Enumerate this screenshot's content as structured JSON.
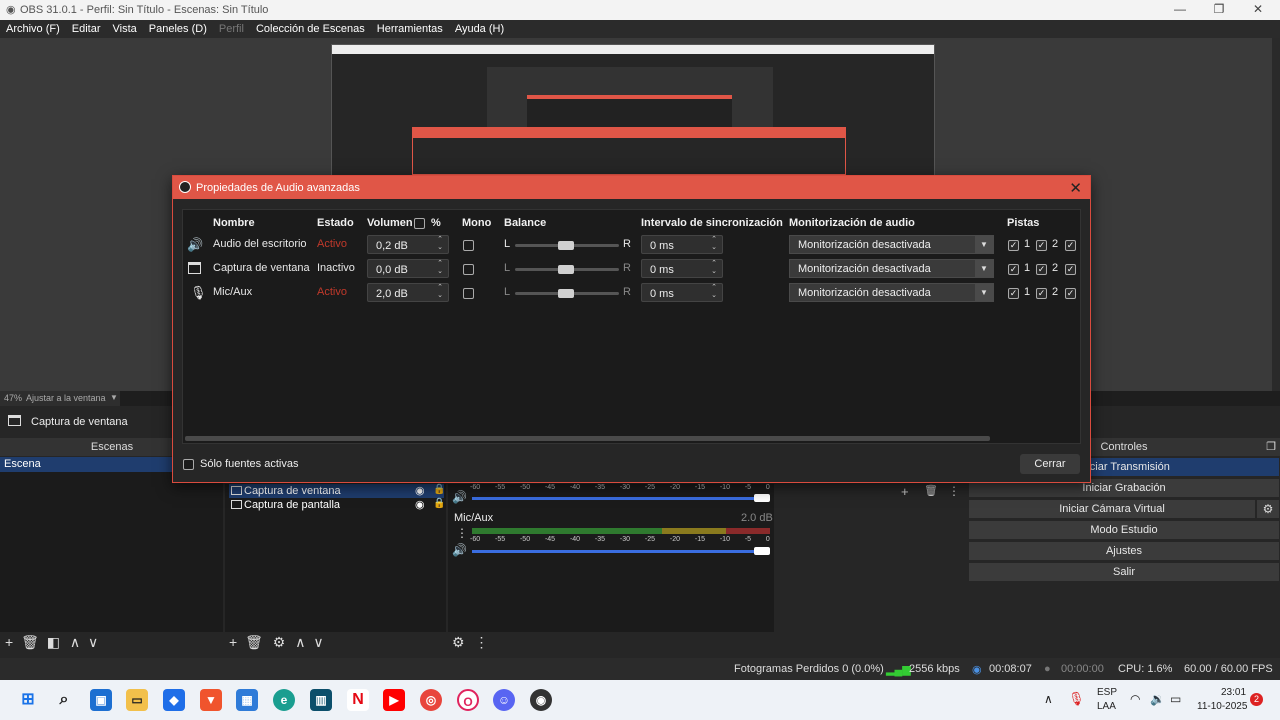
{
  "window": {
    "title": "OBS 31.0.1 - Perfil: Sin Título - Escenas: Sin Título"
  },
  "menu": [
    "Archivo (F)",
    "Editar",
    "Vista",
    "Paneles (D)",
    "Perfil",
    "Colección de Escenas",
    "Herramientas",
    "Ayuda (H)"
  ],
  "zoom": {
    "pct": "47%",
    "label": "Ajustar a la ventana"
  },
  "source_header": {
    "label": "Captura de ventana"
  },
  "scenes": {
    "header": "Escenas",
    "items": [
      "Escena"
    ]
  },
  "sources": {
    "items": [
      "Captura de ventana",
      "Captura de pantalla"
    ]
  },
  "mixer": {
    "ticks": [
      "-60",
      "-55",
      "-50",
      "-45",
      "-40",
      "-35",
      "-30",
      "-25",
      "-20",
      "-15",
      "-10",
      "-5",
      "0"
    ],
    "mic_label": "Mic/Aux",
    "mic_db": "2.0 dB"
  },
  "controls": {
    "header": "Controles",
    "buttons": [
      "Iniciar Transmisión",
      "Iniciar Grabación",
      "Iniciar Cámara Virtual",
      "Modo Estudio",
      "Ajustes",
      "Salir"
    ]
  },
  "status": {
    "dropped": "Fotogramas Perdidos 0 (0.0%)",
    "bitrate": "2556 kbps",
    "stream_time": "00:08:07",
    "rec_time": "00:00:00",
    "cpu": "CPU: 1.6%",
    "fps": "60.00 / 60.00 FPS"
  },
  "dialog": {
    "title": "Propiedades de Audio avanzadas",
    "headers": {
      "name": "Nombre",
      "state": "Estado",
      "volume": "Volumen",
      "pct": "%",
      "mono": "Mono",
      "balance": "Balance",
      "sync": "Intervalo de sincronización",
      "monitor": "Monitorización de audio",
      "tracks": "Pistas"
    },
    "rows": [
      {
        "name": "Audio del escritorio",
        "state": "Activo",
        "volume": "0,2 dB",
        "left": "L",
        "right": "R",
        "sync": "0 ms",
        "monitor": "Monitorización desactivada",
        "t1": "1",
        "t2": "2"
      },
      {
        "name": "Captura de ventana",
        "state": "Inactivo",
        "volume": "0,0 dB",
        "left": "L",
        "right": "R",
        "sync": "0 ms",
        "monitor": "Monitorización desactivada",
        "t1": "1",
        "t2": "2"
      },
      {
        "name": "Mic/Aux",
        "state": "Activo",
        "volume": "2,0 dB",
        "left": "L",
        "right": "R",
        "sync": "0 ms",
        "monitor": "Monitorización desactivada",
        "t1": "1",
        "t2": "2"
      }
    ],
    "active_only": "Sólo fuentes activas",
    "close": "Cerrar"
  },
  "taskbar": {
    "lang1": "ESP",
    "lang2": "LAA",
    "time": "23:01",
    "date": "11-10-2025",
    "badge": "2"
  },
  "colors": {
    "accent": "#e05647",
    "active": "#c0392b",
    "selection": "#1f3d6e"
  }
}
